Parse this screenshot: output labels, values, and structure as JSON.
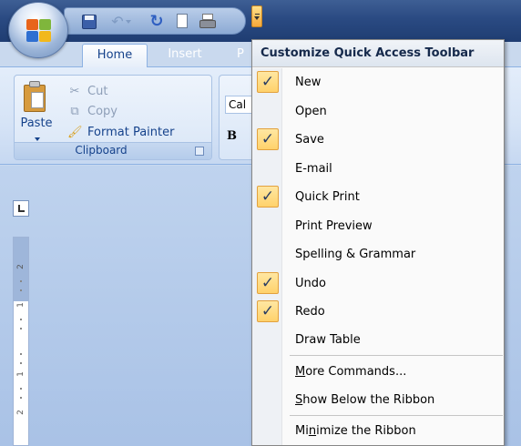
{
  "qat": {
    "icons": [
      "save-icon",
      "undo-icon",
      "redo-icon",
      "new-document-icon",
      "quick-print-icon",
      "customize-qat-dropdown-icon"
    ],
    "colors": {
      "title_bar": "#2a4a82",
      "accent_check": "#ffd26b"
    }
  },
  "tabs": [
    "Home",
    "Insert",
    "P"
  ],
  "clipboard": {
    "paste": "Paste",
    "cut": "Cut",
    "copy": "Copy",
    "format_painter": "Format Painter",
    "group_label": "Clipboard"
  },
  "font": {
    "box": "Cal",
    "bold": "B"
  },
  "ruler": {
    "n2": "2",
    "n1": "1"
  },
  "menu": {
    "title": "Customize Quick Access Toolbar",
    "items": [
      {
        "label": "New",
        "checked": true
      },
      {
        "label": "Open",
        "checked": false
      },
      {
        "label": "Save",
        "checked": true
      },
      {
        "label": "E-mail",
        "checked": false
      },
      {
        "label": "Quick Print",
        "checked": true
      },
      {
        "label": "Print Preview",
        "checked": false
      },
      {
        "label": "Spelling & Grammar",
        "checked": false
      },
      {
        "label": "Undo",
        "checked": true
      },
      {
        "label": "Redo",
        "checked": true
      },
      {
        "label": "Draw Table",
        "checked": false
      }
    ],
    "more_commands": {
      "accel": "M",
      "rest": "ore Commands..."
    },
    "show_below": {
      "accel": "S",
      "rest": "how Below the Ribbon"
    },
    "minimize": {
      "pre": "Mi",
      "accel": "n",
      "rest": "imize the Ribbon"
    },
    "check_glyph": "✓"
  }
}
